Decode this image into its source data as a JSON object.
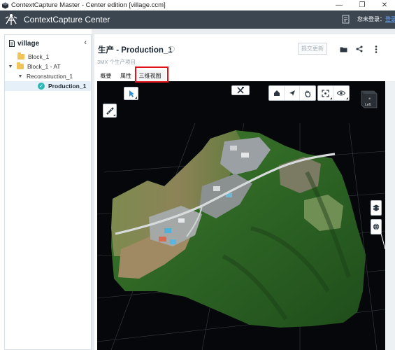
{
  "window": {
    "title": "ContextCapture Master - Center edition [village.ccm]",
    "controls": {
      "minimize": "—",
      "maximize": "❐",
      "close": "✕"
    }
  },
  "appbar": {
    "app_name": "ContextCapture Center",
    "login_text": "您未登录：",
    "login_link": "登录"
  },
  "sidebar": {
    "project_name": "village",
    "collapse": "‹",
    "items": [
      {
        "label": "Block_1",
        "icon": "folder-icon"
      },
      {
        "label": "Block_1 - AT",
        "icon": "folder-icon"
      },
      {
        "label": "Reconstruction_1",
        "icon": "none"
      },
      {
        "label": "Production_1",
        "icon": "check-circle-icon"
      }
    ]
  },
  "main": {
    "job_title": "生产 - Production_1",
    "job_subtitle": "3MX 个生产项目",
    "submit_label": "提交更新",
    "tabs": [
      {
        "label": "概要"
      },
      {
        "label": "属性"
      },
      {
        "label": "三维视图"
      }
    ]
  },
  "view3d": {
    "cube_label": "Left",
    "highlight_color": "#e0151b"
  },
  "colors": {
    "appbar": "#3b4651",
    "tile_accent": "#2eb8b4",
    "view_bg": "#05070a"
  }
}
